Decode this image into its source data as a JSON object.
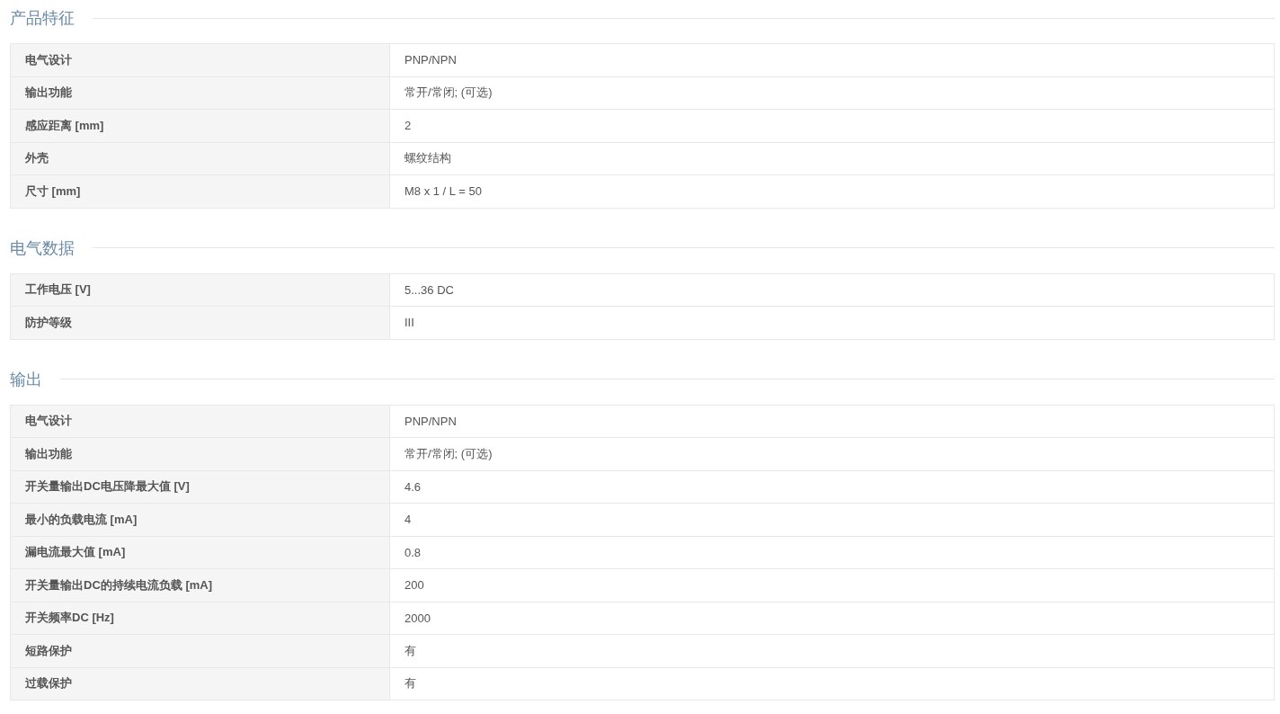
{
  "sections": [
    {
      "title": "产品特征",
      "rows": [
        {
          "label": "电气设计",
          "value": "PNP/NPN"
        },
        {
          "label": "输出功能",
          "value": "常开/常闭; (可选)"
        },
        {
          "label": "感应距离 [mm]",
          "value": "2"
        },
        {
          "label": "外壳",
          "value": "螺纹结构"
        },
        {
          "label": "尺寸 [mm]",
          "value": "M8 x 1 / L = 50"
        }
      ]
    },
    {
      "title": "电气数据",
      "rows": [
        {
          "label": "工作电压 [V]",
          "value": "5...36 DC"
        },
        {
          "label": "防护等级",
          "value": "III"
        }
      ]
    },
    {
      "title": "输出",
      "rows": [
        {
          "label": "电气设计",
          "value": "PNP/NPN"
        },
        {
          "label": "输出功能",
          "value": "常开/常闭; (可选)"
        },
        {
          "label": "开关量输出DC电压降最大值 [V]",
          "value": "4.6"
        },
        {
          "label": "最小的负载电流 [mA]",
          "value": "4"
        },
        {
          "label": "漏电流最大值 [mA]",
          "value": "0.8"
        },
        {
          "label": "开关量输出DC的持续电流负载 [mA]",
          "value": "200"
        },
        {
          "label": "开关频率DC [Hz]",
          "value": "2000"
        },
        {
          "label": "短路保护",
          "value": "有"
        },
        {
          "label": "过载保护",
          "value": "有"
        }
      ]
    }
  ]
}
